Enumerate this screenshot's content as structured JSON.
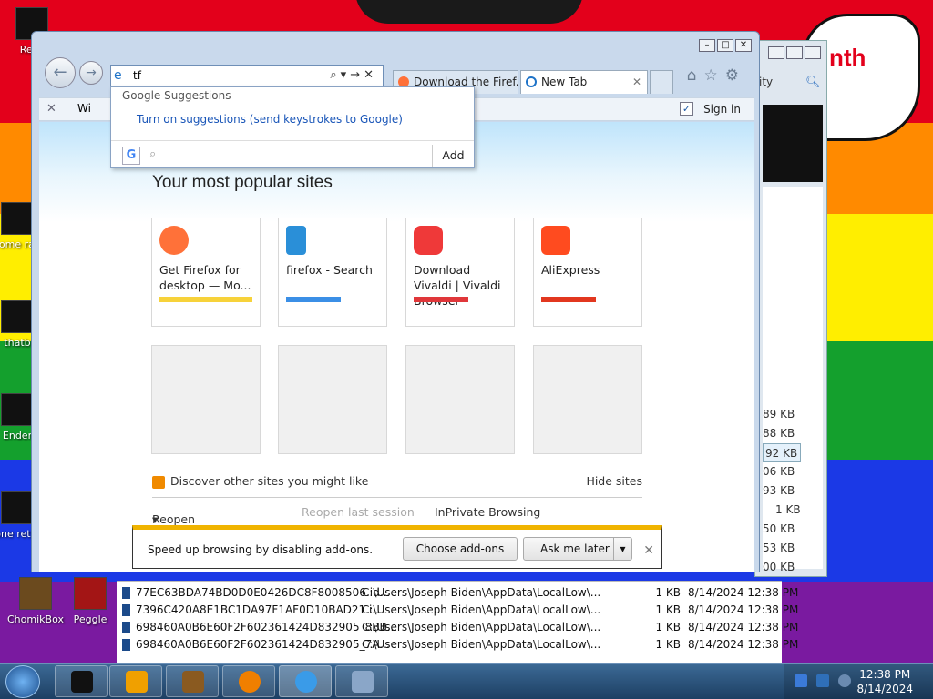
{
  "desktop": {
    "speech_text": "nth",
    "icons": [
      {
        "label": "Recy"
      },
      {
        "label": "some ran"
      },
      {
        "label": "thatb"
      },
      {
        "label": "Ender"
      },
      {
        "label": "none retarc"
      },
      {
        "label": "ChomikBox"
      },
      {
        "label": "Peggle"
      }
    ]
  },
  "background_window": {
    "partial_text": "ity",
    "sizes": [
      "89 KB",
      "88 KB",
      "92 KB",
      "06 KB",
      "93 KB",
      "1 KB",
      "50 KB",
      "53 KB",
      "00 KB"
    ]
  },
  "browser": {
    "address_value": "tf",
    "tabs": [
      {
        "label": "Download the Firef...",
        "active": false
      },
      {
        "label": "New Tab",
        "active": true
      }
    ],
    "favbar": {
      "partial_item": "Wi",
      "sign_in": "Sign in"
    },
    "suggestions": {
      "header": "Google Suggestions",
      "link": "Turn on suggestions (send keystrokes to Google)",
      "provider_letter": "G",
      "add_label": "Add"
    },
    "popular_title": "Your most popular sites",
    "tiles": [
      {
        "title": "Get Firefox for desktop — Mo...",
        "color": "#f7d23a",
        "logo_color": "#ff7139"
      },
      {
        "title": "firefox - Search",
        "color": "#3b8fe6",
        "logo_color": "#2a8fd8"
      },
      {
        "title": "Download Vivaldi | Vivaldi Browser",
        "color": "#e0373a",
        "logo_color": "#ef3939"
      },
      {
        "title": "AliExpress",
        "color": "#e2371f",
        "logo_color": "#ff4b1f"
      }
    ],
    "discover_label": "Discover other sites you might like",
    "hide_sites": "Hide sites",
    "reopen_closed": "Reopen closed tabs",
    "reopen_last": "Reopen last session",
    "inprivate": "InPrivate Browsing",
    "notification": {
      "message": "Speed up browsing by disabling add-ons.",
      "choose": "Choose add-ons",
      "ask_later": "Ask me later"
    }
  },
  "files": [
    {
      "name": "77EC63BDA74BD0D0E0426DC8F8008506.id...",
      "path": "C:\\Users\\Joseph Biden\\AppData\\LocalLow\\...",
      "size": "1 KB",
      "date": "8/14/2024 12:38 PM"
    },
    {
      "name": "7396C420A8E1BC1DA97F1AF0D10BAD21.i...",
      "path": "C:\\Users\\Joseph Biden\\AppData\\LocalLow\\...",
      "size": "1 KB",
      "date": "8/14/2024 12:38 PM"
    },
    {
      "name": "698460A0B6E60F2F602361424D832905_8BB...",
      "path": "C:\\Users\\Joseph Biden\\AppData\\LocalLow\\...",
      "size": "1 KB",
      "date": "8/14/2024 12:38 PM"
    },
    {
      "name": "698460A0B6E60F2F602361424D832905_7A...",
      "path": "C:\\Users\\Joseph Biden\\AppData\\LocalLow\\...",
      "size": "1 KB",
      "date": "8/14/2024 12:38 PM"
    }
  ],
  "taskbar": {
    "time": "12:38 PM",
    "date": "8/14/2024"
  },
  "colors": {
    "accent": "#1e73c8",
    "notif_bar": "#f0b400"
  }
}
